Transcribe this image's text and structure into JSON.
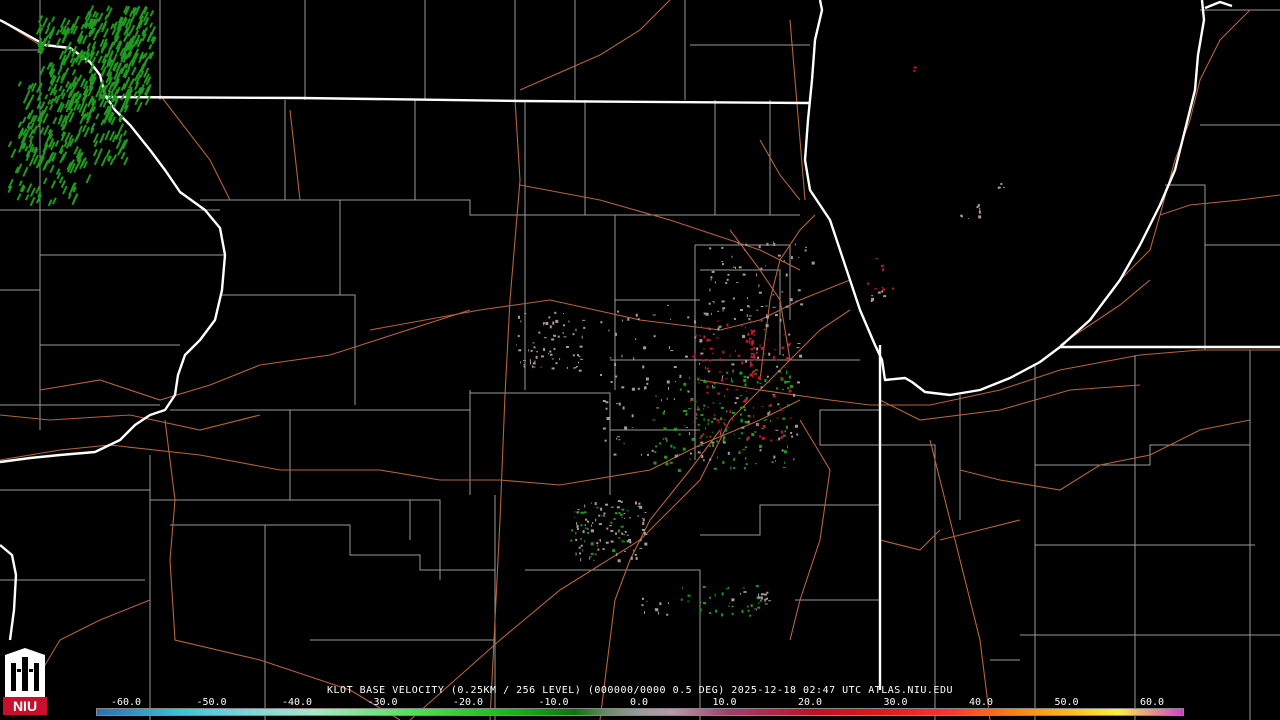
{
  "caption": "KLOT BASE VELOCITY (0.25KM / 256 LEVEL) (000000/0000 0.5 DEG) 2025-12-18 02:47 UTC  ATLAS.NIU.EDU",
  "scale_ticks": [
    "-60.0",
    "-50.0",
    "-40.0",
    "-30.0",
    "-20.0",
    "-10.0",
    "0.0",
    "10.0",
    "20.0",
    "30.0",
    "40.0",
    "50.0",
    "60.0"
  ],
  "logo_text": "NIU",
  "colors": {
    "state_borders": "#ffffff",
    "county_borders": "#9a9a9a",
    "roads": "#b5643c",
    "inbound": "#1f9a1f",
    "outbound": "#c01a2a",
    "near_zero": "#a89a9a"
  }
}
